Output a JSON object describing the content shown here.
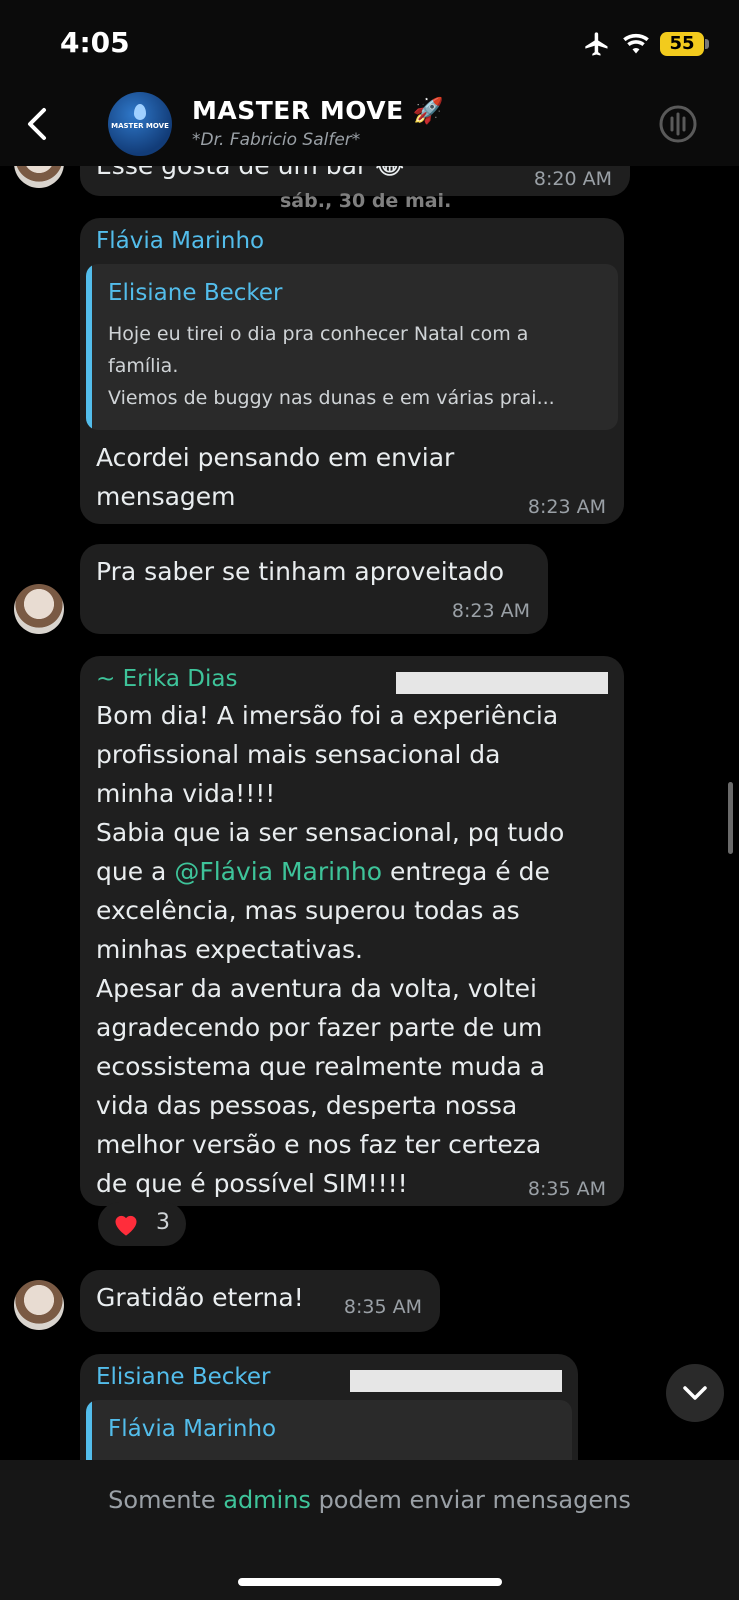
{
  "status": {
    "time": "4:05",
    "battery": "55"
  },
  "header": {
    "avatar_text": "MASTER MOVE",
    "title": "MASTER MOVE 🚀",
    "subtitle": "*Dr. Fabricio Salfer*"
  },
  "chat": {
    "top_partial": {
      "text": "Esse gosta de um bar 😂",
      "time": "8:20 AM"
    },
    "date_separator": "sáb., 30 de mai.",
    "msg1": {
      "sender": "Flávia Marinho",
      "quote_sender": "Elisiane Becker",
      "quote_line1": "Hoje eu tirei o dia pra conhecer Natal com a",
      "quote_line2": "família.",
      "quote_line3": "Viemos de buggy nas dunas e em várias prai...",
      "text_line1": "Acordei pensando em enviar",
      "text_line2": "mensagem",
      "time": "8:23 AM"
    },
    "msg2": {
      "text": "Pra saber se tinham aproveitado",
      "time": "8:23 AM"
    },
    "msg3": {
      "sender": "~ Erika Dias",
      "lines": [
        "Bom dia! A imersão foi a experiência",
        "profissional mais sensacional da",
        "minha vida!!!!",
        "Sabia que ia ser sensacional, pq tudo",
        "que a ",
        " entrega é de",
        "excelência, mas superou todas as",
        "minhas expectativas.",
        "Apesar da aventura da volta, voltei",
        "agradecendo por fazer parte de um",
        "ecossistema que realmente muda a",
        "vida das pessoas, desperta nossa",
        "melhor versão e nos faz ter certeza",
        "de que é possível SIM!!!!"
      ],
      "mention": "@Flávia Marinho",
      "time": "8:35 AM",
      "reaction_count": "3"
    },
    "msg4": {
      "text": "Gratidão eterna!",
      "time": "8:35 AM"
    },
    "msg5": {
      "sender": "Elisiane Becker",
      "quote_sender": "Flávia Marinho"
    }
  },
  "footer": {
    "prefix": "Somente ",
    "admins": "admins",
    "suffix": " podem enviar mensagens"
  }
}
